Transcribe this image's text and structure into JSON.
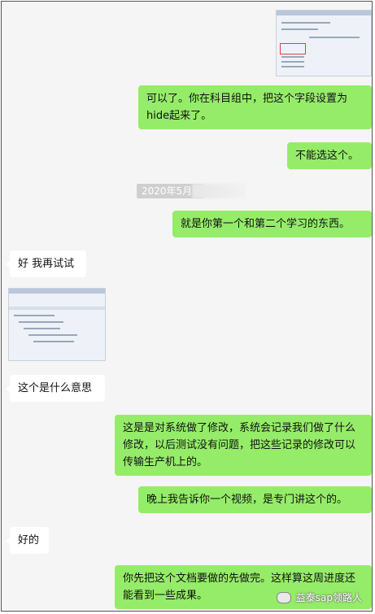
{
  "messages": [
    {
      "text": "可以了。你在科目组中，把这个字段设置为hide起来了。"
    },
    {
      "text": "不能选这个。"
    },
    {
      "text": "就是你第一个和第二个学习的东西。"
    },
    {
      "text": "好 我再试试"
    },
    {
      "text": "这个是什么意思"
    },
    {
      "text": "这是是对系统做了修改，系统会记录我们做了什么修改，以后测试没有问题，把这些记录的修改可以传输生产机上的。"
    },
    {
      "text": "晚上我告诉你一个视频，是专门讲这个的。"
    },
    {
      "text": "好的"
    },
    {
      "text": "你先把这个文档要做的先做完。这样算这周进度还能看到一些成果。"
    }
  ],
  "timestamp": "2020年5月2",
  "watermark": "益泰sap领路人",
  "colors": {
    "sent": "#95ec69",
    "received": "#ffffff",
    "background": "#f5f5f5"
  }
}
